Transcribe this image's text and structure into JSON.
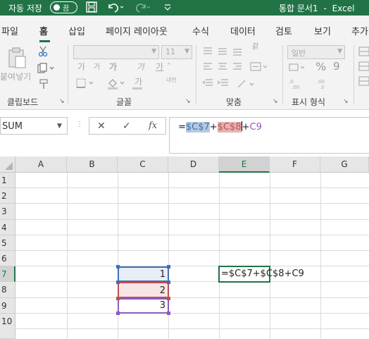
{
  "titlebar": {
    "autosave_label": "자동 저장",
    "toggle_label": "끔",
    "document_title": "통합 문서1",
    "separator": "-",
    "app_name": "Excel",
    "qat_icons": [
      "save-icon",
      "undo-icon",
      "redo-icon",
      "customize-icon"
    ]
  },
  "ribbon_tabs": [
    "파일",
    "홈",
    "삽입",
    "페이지 레이아웃",
    "수식",
    "데이터",
    "검토",
    "보기",
    "추가"
  ],
  "active_tab": "홈",
  "ribbon": {
    "clipboard": {
      "paste_label": "붙여넣기",
      "group_label": "클립보드"
    },
    "font": {
      "font_name": "",
      "font_size": "11",
      "grow_label": "가",
      "shrink_label": "가",
      "bold_label": "가",
      "italic_label": "가",
      "underline_label": "가",
      "font_color_label": "가",
      "phonetic_label": "내천",
      "group_label": "글꼴"
    },
    "alignment": {
      "wrap_label": "갉",
      "group_label": "맞춤"
    },
    "number": {
      "format": "일반",
      "group_label": "표시 형식"
    }
  },
  "formula_bar": {
    "name_box": "SUM",
    "cancel_icon": "✕",
    "enter_icon": "✓",
    "fx_label": "fx",
    "formula_prefix": "=",
    "ref1": "$C$7",
    "op1": "+",
    "ref2": "$C$8",
    "op2": "+",
    "ref3": "C9"
  },
  "grid": {
    "columns": [
      "A",
      "B",
      "C",
      "D",
      "E",
      "F",
      "G"
    ],
    "rows": [
      "1",
      "2",
      "3",
      "4",
      "5",
      "6",
      "7",
      "8",
      "9",
      "10"
    ],
    "selected_column": "E",
    "selected_row": "7",
    "cells": {
      "C7": "1",
      "C8": "2",
      "C9": "3",
      "E7": "=$C$7+$C$8+C9"
    }
  },
  "colors": {
    "excel_green": "#217346",
    "ref1_blue": "#3e6fb5",
    "ref2_red": "#c0504d",
    "ref3_purple": "#8d59c2"
  }
}
